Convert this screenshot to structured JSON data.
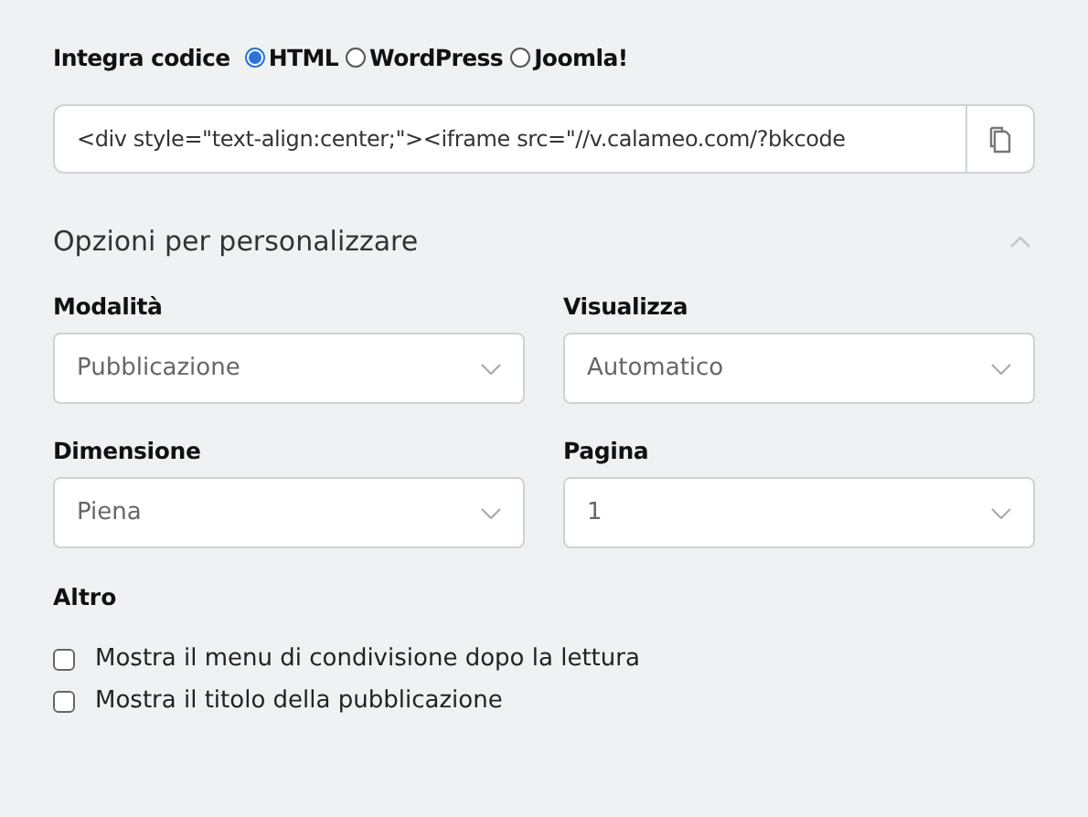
{
  "embed": {
    "label": "Integra codice",
    "formats": [
      {
        "label": "HTML",
        "selected": true
      },
      {
        "label": "WordPress",
        "selected": false
      },
      {
        "label": "Joomla!",
        "selected": false
      }
    ],
    "code": "<div style=\"text-align:center;\"><iframe src=\"//v.calameo.com/?bkcode"
  },
  "options": {
    "title": "Opzioni per personalizzare",
    "expanded": true,
    "selects": [
      {
        "label": "Modalità",
        "value": "Pubblicazione"
      },
      {
        "label": "Visualizza",
        "value": "Automatico"
      },
      {
        "label": "Dimensione",
        "value": "Piena"
      },
      {
        "label": "Pagina",
        "value": "1"
      }
    ],
    "other": {
      "label": "Altro",
      "checkboxes": [
        {
          "label": "Mostra il menu di condivisione dopo la lettura",
          "checked": false
        },
        {
          "label": "Mostra il titolo della pubblicazione",
          "checked": false
        }
      ]
    }
  }
}
